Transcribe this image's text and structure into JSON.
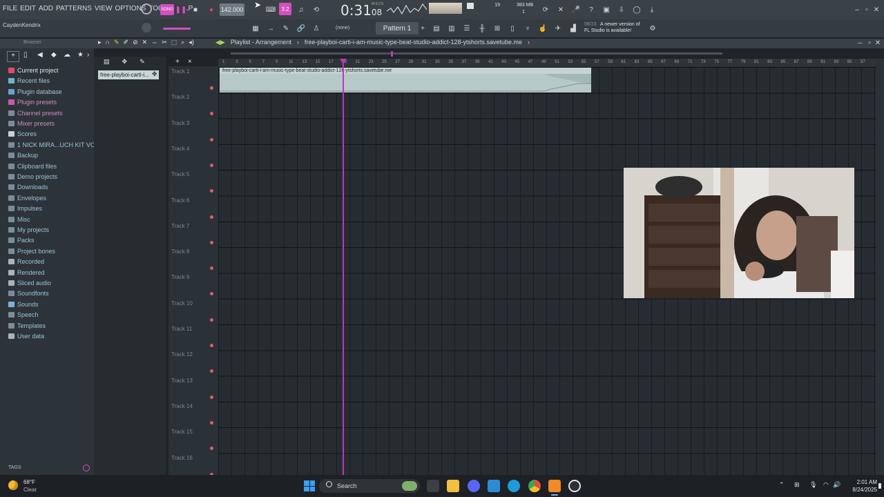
{
  "menu": [
    "FILE",
    "EDIT",
    "ADD",
    "PATTERNS",
    "VIEW",
    "OPTIONS",
    "TOOLS",
    "HELP"
  ],
  "transport": {
    "tempo": "142.000",
    "time": "0:31",
    "time_small": "08",
    "time_unit": "M:S:CS",
    "cpu_label": "19",
    "ram": "383 MB",
    "voices": "1"
  },
  "toolbar": {
    "pattern": "Pattern 1",
    "none_selector": "(none)",
    "news_date": "08/23",
    "news_text_1": "A newer version of",
    "news_text_2": "FL Studio is available!"
  },
  "user": {
    "name": "CaydenKendrix"
  },
  "browser": {
    "header": "Browser",
    "items": [
      {
        "label": "Current project",
        "icon": "project-icon"
      },
      {
        "label": "Recent files",
        "icon": "recent-icon"
      },
      {
        "label": "Plugin database",
        "icon": "plugin-icon"
      },
      {
        "label": "Plugin presets",
        "icon": "preset-icon"
      },
      {
        "label": "Channel presets",
        "icon": "folder-icon"
      },
      {
        "label": "Mixer presets",
        "icon": "folder-icon"
      },
      {
        "label": "Scores",
        "icon": "note-icon"
      },
      {
        "label": "1 NICK MIRA...UCH KIT VOL 1",
        "icon": "folder-icon"
      },
      {
        "label": "Backup",
        "icon": "folder-icon"
      },
      {
        "label": "Clipboard files",
        "icon": "folder-icon"
      },
      {
        "label": "Demo projects",
        "icon": "folder-icon"
      },
      {
        "label": "Downloads",
        "icon": "folder-icon"
      },
      {
        "label": "Envelopes",
        "icon": "folder-icon"
      },
      {
        "label": "Impulses",
        "icon": "folder-icon"
      },
      {
        "label": "Misc",
        "icon": "folder-icon"
      },
      {
        "label": "My projects",
        "icon": "folder-icon"
      },
      {
        "label": "Packs",
        "icon": "folder-icon"
      },
      {
        "label": "Project bones",
        "icon": "folder-icon"
      },
      {
        "label": "Recorded",
        "icon": "plus-icon"
      },
      {
        "label": "Rendered",
        "icon": "plus-icon"
      },
      {
        "label": "Sliced audio",
        "icon": "plus-icon"
      },
      {
        "label": "Soundfonts",
        "icon": "folder-icon"
      },
      {
        "label": "Sounds",
        "icon": "cloud-icon"
      },
      {
        "label": "Speech",
        "icon": "folder-icon"
      },
      {
        "label": "Templates",
        "icon": "folder-icon"
      },
      {
        "label": "User data",
        "icon": "user-icon"
      }
    ],
    "tags_label": "TAGS"
  },
  "playlist": {
    "caption": "Playlist - Arrangement",
    "file": "free-playboi-carti-i-am-music-type-beat-studio-addict-128-ytshorts.savetube.me",
    "picker_item": "free-playboi-carti-i...",
    "clip_label": "free-playboi-carti-i-am-music-type-beat-studio-addict-128-ytshorts.savetube.me",
    "tracks": [
      "Track 1",
      "Track 2",
      "Track 3",
      "Track 4",
      "Track 5",
      "Track 6",
      "Track 7",
      "Track 8",
      "Track 9",
      "Track 10",
      "Track 11",
      "Track 12",
      "Track 13",
      "Track 14",
      "Track 15",
      "Track 16"
    ],
    "ruler": [
      "1",
      "3",
      "5",
      "7",
      "9",
      "11",
      "13",
      "15",
      "17",
      "19",
      "21",
      "23",
      "25",
      "27",
      "29",
      "31",
      "33",
      "35",
      "37",
      "39",
      "41",
      "43",
      "45",
      "47",
      "49",
      "51",
      "53",
      "55",
      "57",
      "59",
      "61",
      "63",
      "65",
      "67",
      "69",
      "71",
      "73",
      "75",
      "77",
      "79",
      "81",
      "83",
      "85",
      "87",
      "89",
      "91",
      "93",
      "95",
      "97"
    ]
  },
  "taskbar": {
    "weather_temp": "68°F",
    "weather_desc": "Clear",
    "search": "Search",
    "time": "2:01 AM",
    "date": "8/24/2025"
  },
  "colors": {
    "playhead": "#c236b8",
    "clip": "#a3b8b8",
    "track_dot": "#e05c6c",
    "accent": "#d44fbf"
  }
}
